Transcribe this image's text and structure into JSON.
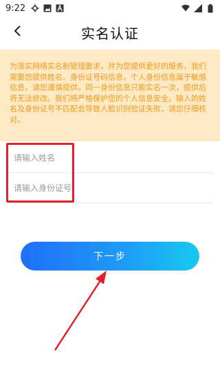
{
  "status_bar": {
    "time": "9:22"
  },
  "header": {
    "title": "实名认证"
  },
  "notice": {
    "text": "为落实网络实名制管理要求，并为您提供更好的服务，我们需要您提供姓名、身份证号码信息，个人身份信息属于敏感信息，请您谨慎提供。同一身份信息只能实名一次，提供后将无法修改。我们将严格保护您的个人信息安全。输入的姓名及身份证号不匹配会导致人脸识别验证失败，请您仔细核对。"
  },
  "form": {
    "name_placeholder": "请输入姓名",
    "id_placeholder": "请输入身份证号"
  },
  "actions": {
    "next_label": "下一步"
  },
  "colors": {
    "notice_bg": "#fde9c4",
    "notice_text": "#f09a1a",
    "button_start": "#1f6ff7",
    "button_end": "#16c9f0",
    "annotation": "#e0202a"
  }
}
